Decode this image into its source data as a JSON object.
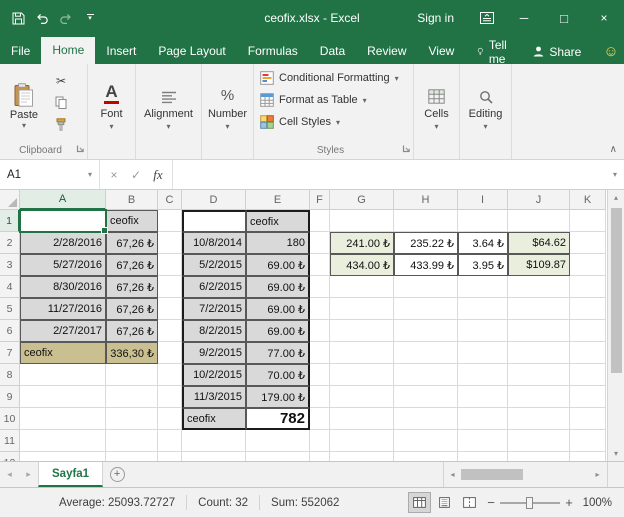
{
  "titlebar": {
    "title": "ceofix.xlsx - Excel",
    "sign_in": "Sign in"
  },
  "ribbon": {
    "tabs": [
      {
        "label": "File",
        "active": false
      },
      {
        "label": "Home",
        "active": true
      },
      {
        "label": "Insert",
        "active": false
      },
      {
        "label": "Page Layout",
        "active": false
      },
      {
        "label": "Formulas",
        "active": false
      },
      {
        "label": "Data",
        "active": false
      },
      {
        "label": "Review",
        "active": false
      },
      {
        "label": "View",
        "active": false
      }
    ],
    "tell_me": "Tell me",
    "share": "Share",
    "clipboard": {
      "label": "Clipboard",
      "paste": "Paste"
    },
    "collapsed_groups": [
      "Font",
      "Alignment",
      "Number",
      "Cells",
      "Editing"
    ],
    "styles_group": {
      "label": "Styles",
      "items": [
        "Conditional Formatting",
        "Format as Table",
        "Cell Styles"
      ]
    }
  },
  "formula_bar": {
    "name_box": "A1",
    "formula_value": ""
  },
  "sheet": {
    "selection": "A1",
    "selected_column": "A",
    "selected_row": 1,
    "visible_rows": 12,
    "columns": [
      {
        "letter": "A",
        "width": 86
      },
      {
        "letter": "B",
        "width": 52
      },
      {
        "letter": "C",
        "width": 24
      },
      {
        "letter": "D",
        "width": 64
      },
      {
        "letter": "E",
        "width": 64
      },
      {
        "letter": "F",
        "width": 20
      },
      {
        "letter": "G",
        "width": 64
      },
      {
        "letter": "H",
        "width": 64
      },
      {
        "letter": "I",
        "width": 50
      },
      {
        "letter": "J",
        "width": 62
      },
      {
        "letter": "K",
        "width": 36
      }
    ],
    "cells": {
      "B1": {
        "t": "ceofix",
        "c": "gray bd"
      },
      "D1": {
        "t": "",
        "c": "bd tkl tkt"
      },
      "E1": {
        "t": "ceofix",
        "c": "gray bd tkt tkr"
      },
      "A2": {
        "t": "2/28/2016",
        "c": "gray bd right"
      },
      "B2": {
        "t": "67,26 ₺",
        "c": "gray bd right"
      },
      "D2": {
        "t": "10/8/2014",
        "c": "gray bd right tkl"
      },
      "E2": {
        "t": "180",
        "c": "gray bd right tkr"
      },
      "G2": {
        "t": "241.00 ₺",
        "c": "green bd right"
      },
      "H2": {
        "t": "235.22 ₺",
        "c": "bd right"
      },
      "I2": {
        "t": "3.64 ₺",
        "c": "bd right"
      },
      "J2": {
        "t": "$64.62",
        "c": "green bd right"
      },
      "A3": {
        "t": "5/27/2016",
        "c": "gray bd right"
      },
      "B3": {
        "t": "67,26 ₺",
        "c": "gray bd right"
      },
      "D3": {
        "t": "5/2/2015",
        "c": "gray bd right tkl"
      },
      "E3": {
        "t": "69.00 ₺",
        "c": "gray bd right tkr"
      },
      "G3": {
        "t": "434.00 ₺",
        "c": "green bd right"
      },
      "H3": {
        "t": "433.99 ₺",
        "c": "bd right"
      },
      "I3": {
        "t": "3.95 ₺",
        "c": "bd right"
      },
      "J3": {
        "t": "$109.87",
        "c": "green bd right"
      },
      "A4": {
        "t": "8/30/2016",
        "c": "gray bd right"
      },
      "B4": {
        "t": "67,26 ₺",
        "c": "gray bd right"
      },
      "D4": {
        "t": "6/2/2015",
        "c": "gray bd right tkl"
      },
      "E4": {
        "t": "69.00 ₺",
        "c": "gray bd right tkr"
      },
      "A5": {
        "t": "11/27/2016",
        "c": "gray bd right"
      },
      "B5": {
        "t": "67,26 ₺",
        "c": "gray bd right"
      },
      "D5": {
        "t": "7/2/2015",
        "c": "gray bd right tkl"
      },
      "E5": {
        "t": "69.00 ₺",
        "c": "gray bd right tkr"
      },
      "A6": {
        "t": "2/27/2017",
        "c": "gray bd right"
      },
      "B6": {
        "t": "67,26 ₺",
        "c": "gray bd right"
      },
      "D6": {
        "t": "8/2/2015",
        "c": "gray bd right tkl"
      },
      "E6": {
        "t": "69.00 ₺",
        "c": "gray bd right tkr"
      },
      "A7": {
        "t": "ceofix",
        "c": "tan bd"
      },
      "B7": {
        "t": "336,30 ₺",
        "c": "tan bd right"
      },
      "D7": {
        "t": "9/2/2015",
        "c": "gray bd right tkl"
      },
      "E7": {
        "t": "77.00 ₺",
        "c": "gray bd right tkr"
      },
      "D8": {
        "t": "10/2/2015",
        "c": "gray bd right tkl"
      },
      "E8": {
        "t": "70.00 ₺",
        "c": "gray bd right tkr"
      },
      "D9": {
        "t": "11/3/2015",
        "c": "gray bd right tkl"
      },
      "E9": {
        "t": "179.00 ₺",
        "c": "gray bd right tkr"
      },
      "D10": {
        "t": "ceofix",
        "c": "gray bd tkl tkb"
      },
      "E10": {
        "t": "782",
        "c": "bd right bold big tkr tkb"
      }
    }
  },
  "sheet_tabs": {
    "active_sheet": "Sayfa1"
  },
  "status_bar": {
    "average": "Average: 25093.72727",
    "count": "Count: 32",
    "sum": "Sum: 552062",
    "zoom": "100%"
  },
  "colors": {
    "accent_green": "#217346",
    "cell_gray": "#d9d9d9",
    "cell_tan": "#cabf91",
    "cell_green": "#e9efdc",
    "thick_border": "#1c1c1c"
  },
  "icons": {
    "dropdown": "▾",
    "scissors": "✂",
    "minimize": "─",
    "maximize": "□",
    "close": "×",
    "smiley": "☺",
    "cancel": "×",
    "enter": "✓",
    "fx": "fx",
    "collapse_ribbon": "∧",
    "scroll_up": "▴",
    "scroll_down": "▾",
    "scroll_left": "◂",
    "scroll_right": "▸",
    "tab_nav_left": "◂",
    "tab_nav_right": "▸",
    "add_sheet": "+",
    "zoom_out": "−",
    "zoom_in": "+",
    "percent_sign": "%",
    "font_letter": "A"
  }
}
